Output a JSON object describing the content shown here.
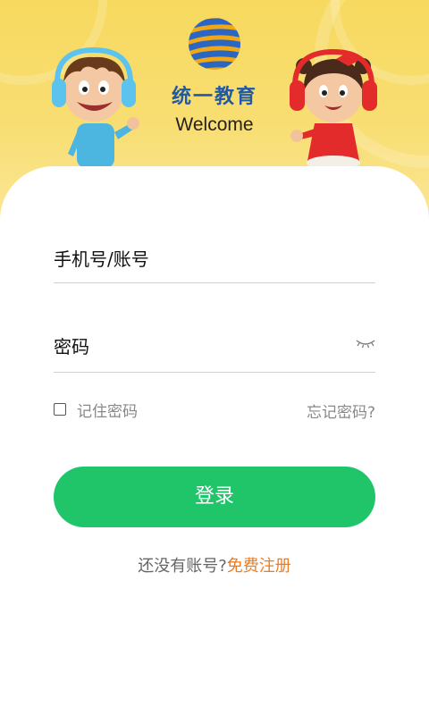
{
  "header": {
    "brand": "统一教育",
    "welcome": "Welcome"
  },
  "form": {
    "account_label": "手机号/账号",
    "password_label": "密码",
    "remember_label": "记住密码",
    "remember_checked": false,
    "forgot_label": "忘记密码?",
    "login_label": "登录"
  },
  "register": {
    "prompt": "还没有账号?",
    "link": "免费注册"
  },
  "colors": {
    "header_bg": "#f7d95f",
    "primary_button": "#20c56a",
    "link_accent": "#ee7b1f",
    "brand_blue": "#1f5aa8"
  },
  "icons": {
    "logo": "globe-logo-icon",
    "password_toggle": "eye-closed-icon",
    "checkbox": "checkbox-icon"
  }
}
